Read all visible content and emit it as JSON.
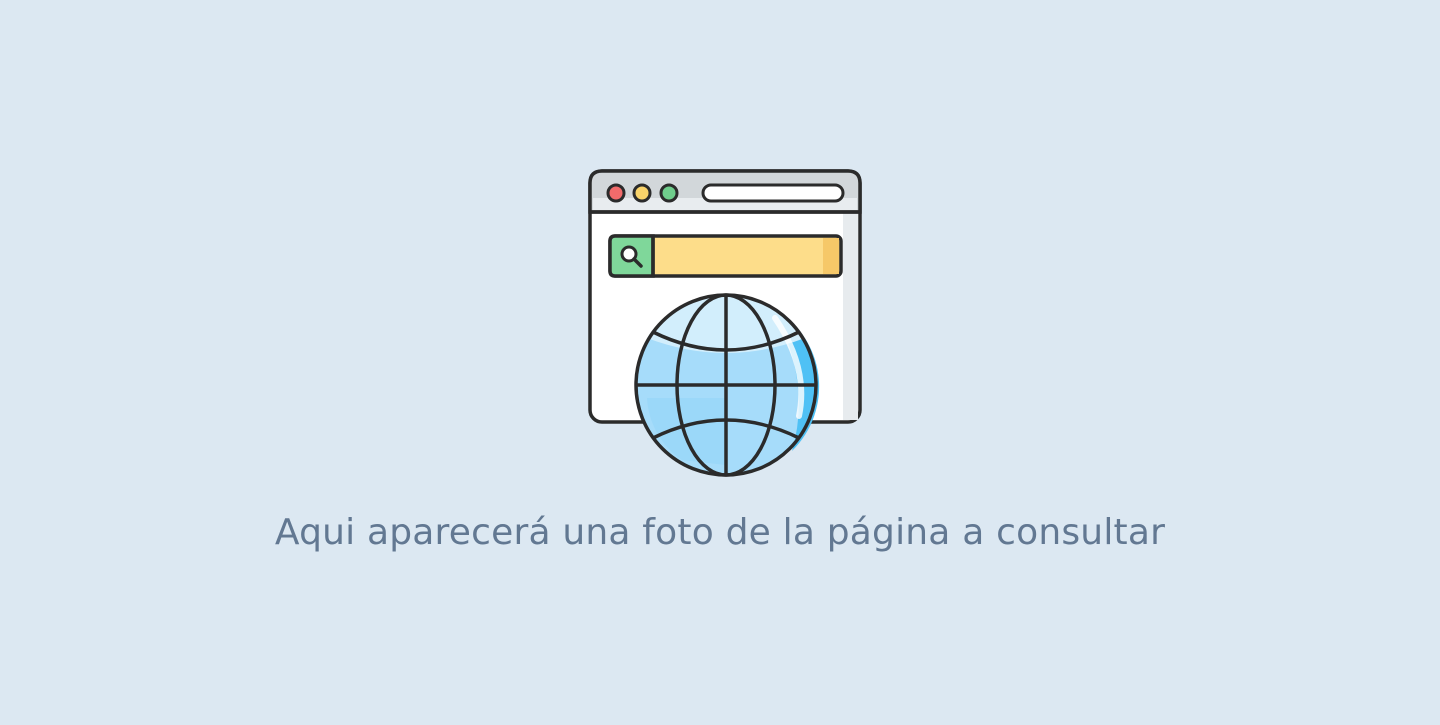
{
  "placeholder": {
    "message": "Aqui aparecerá una foto de la página a consultar",
    "icons": {
      "browser": "browser-window-icon",
      "search": "search-icon",
      "globe": "globe-icon"
    },
    "colors": {
      "background": "#dce8f2",
      "text": "#627892",
      "outline": "#2b2b2b",
      "dot_red": "#f26b6b",
      "dot_yellow": "#f9d36a",
      "dot_green": "#6fce8c",
      "search_bar": "#fddd8a",
      "search_button": "#7fd79a",
      "globe_light": "#a6dcfa",
      "globe_dark": "#4fc1f5"
    }
  }
}
